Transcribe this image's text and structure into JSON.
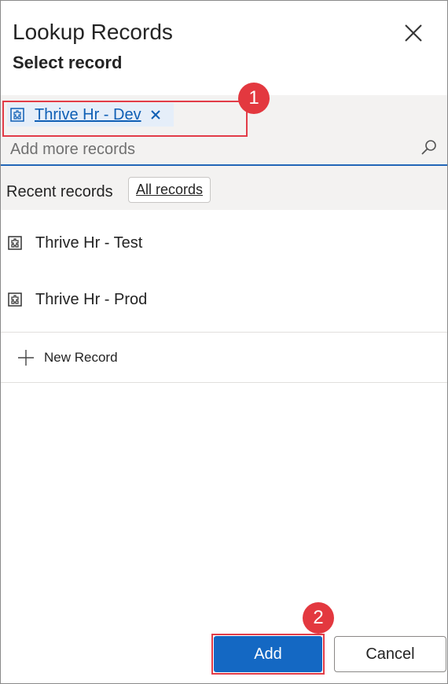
{
  "dialog": {
    "title": "Lookup Records",
    "subtitle": "Select record"
  },
  "selected": {
    "chip_label": "Thrive Hr - Dev",
    "chip_icon": "record-entity-icon"
  },
  "search": {
    "placeholder": "Add more records",
    "value": ""
  },
  "filter": {
    "recent_label": "Recent records",
    "all_records_label": "All records"
  },
  "records": [
    {
      "label": "Thrive Hr - Test",
      "icon": "record-entity-icon"
    },
    {
      "label": "Thrive Hr - Prod",
      "icon": "record-entity-icon"
    }
  ],
  "new_record": {
    "label": "New Record"
  },
  "footer": {
    "add_label": "Add",
    "cancel_label": "Cancel"
  },
  "annotations": [
    {
      "number": "1"
    },
    {
      "number": "2"
    }
  ],
  "colors": {
    "accent": "#1468c3",
    "highlight": "#e23c48",
    "badge": "#e3383f"
  }
}
